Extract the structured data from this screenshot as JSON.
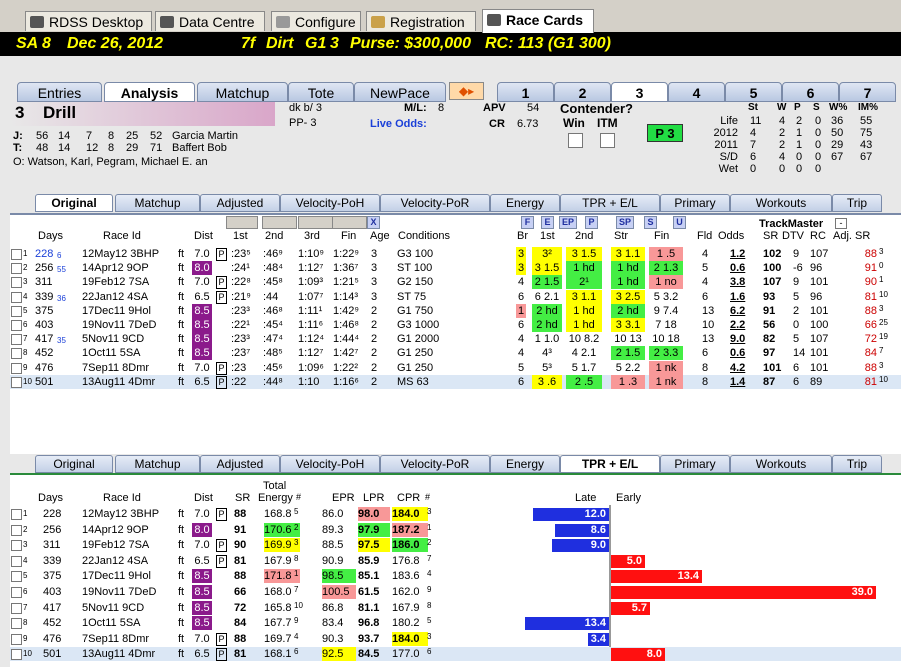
{
  "top_tabs": [
    {
      "label": "RDSS Desktop",
      "icon": "horse-icon"
    },
    {
      "label": "Data Centre",
      "icon": "database-icon"
    },
    {
      "label": "Configure",
      "icon": "gear-icon"
    },
    {
      "label": "Registration",
      "icon": "key-icon"
    },
    {
      "label": "Race Cards",
      "icon": "document-icon"
    }
  ],
  "header": {
    "track": "SA",
    "race": "8",
    "date": "Dec 26, 2012",
    "dist": "7f",
    "surface": "Dirt",
    "grade": "G1",
    "num": "3",
    "purse": "Purse: $300,000",
    "rc": "RC: 113  (G1 300)"
  },
  "race_tabs": [
    "1",
    "2",
    "3",
    "4",
    "5",
    "6",
    "7"
  ],
  "view_tabs": [
    "Entries",
    "Analysis",
    "Matchup",
    "Tote",
    "NewPace"
  ],
  "horse": {
    "num": "3",
    "name": "Drill",
    "dk": "dk b/  3",
    "pp": "PP- 3",
    "ml_label": "M/L:",
    "ml": "8",
    "odds_label": "Live Odds:",
    "apv_label": "APV",
    "apv": "54",
    "cr_label": "CR",
    "cr": "6.73",
    "contender": "Contender?",
    "win": "Win",
    "itm": "ITM",
    "p_label": "P 3"
  },
  "connections": {
    "j": [
      "J:",
      "56",
      "14",
      "7",
      "8",
      "25",
      "52",
      "Garcia Martin"
    ],
    "t": [
      "T:",
      "48",
      "14",
      "12",
      "8",
      "29",
      "71",
      "Baffert Bob"
    ],
    "o": "O:  Watson, Karl, Pegram, Michael E. an"
  },
  "stats": {
    "cols": [
      "St",
      "W",
      "P",
      "S",
      "W%",
      "IM%"
    ],
    "rows": [
      [
        "Life",
        "11",
        "4",
        "2",
        "0",
        "36",
        "55"
      ],
      [
        "2012",
        "4",
        "2",
        "1",
        "0",
        "50",
        "75"
      ],
      [
        "2011",
        "7",
        "2",
        "1",
        "0",
        "29",
        "43"
      ],
      [
        "S/D",
        "6",
        "4",
        "0",
        "0",
        "67",
        "67"
      ],
      [
        "Wet",
        "0",
        "0",
        "0",
        "0",
        "",
        ""
      ]
    ]
  },
  "sub_tabs": [
    "Original",
    "Matchup",
    "Adjusted",
    "Velocity-PoH",
    "Velocity-PoR",
    "Energy",
    "TPR + E/L",
    "Primary",
    "Workouts",
    "Trip"
  ],
  "grid1": {
    "headers": {
      "days": "Days",
      "race_id": "Race Id",
      "dist": "Dist",
      "c1": "1st",
      "c2": "2nd",
      "c3": "3rd",
      "fin": "Fin",
      "age": "Age",
      "cond": "Conditions",
      "br": "Br",
      "p1": "1st",
      "p2": "2nd",
      "str": "Str",
      "pfin": "Fin",
      "fld": "Fld",
      "odds": "Odds",
      "trackmaster": "TrackMaster",
      "sr": "SR",
      "dtv": "DTV",
      "rc": "RC",
      "adjsr": "Adj. SR",
      "f": "F",
      "e": "E",
      "ep": "EP",
      "p": "P",
      "sp": "SP",
      "s": "S",
      "u": "U",
      "x": "X"
    },
    "rows": [
      {
        "n": "1",
        "days": "228",
        "ds": "6",
        "id": "12May12 3BHP",
        "surf": "ft",
        "dist": "7.0",
        "dc": "",
        "pm": "P",
        "c1": ":23⁵",
        "c2": ":46⁹",
        "c3": "1:10⁹",
        "fin": "1:22⁹",
        "age": "3",
        "cond": "G3 100",
        "br": "3",
        "p1": "3²",
        "p2": "3 1.5",
        "str": "3 1.1",
        "pfin": "1 .5",
        "fld": "4",
        "odds": "1.2",
        "sr": "102",
        "dtv": "9",
        "rc": "107",
        "adj": "88",
        "as": "3"
      },
      {
        "n": "2",
        "days": "256",
        "ds": "55",
        "id": "14Apr12 9OP",
        "surf": "ft",
        "dist": "8.0",
        "dc": "pp",
        "pm": "",
        "c1": ":24¹",
        "c2": ":48⁴",
        "c3": "1:12⁷",
        "fin": "1:36⁷",
        "age": "3",
        "cond": "ST 100",
        "br": "3",
        "p1": "3 1.5",
        "p2": "1 hd",
        "str": "1 hd",
        "pfin": "2 1.3",
        "fld": "5",
        "odds": "0.6",
        "sr": "100",
        "dtv": "-6",
        "rc": "96",
        "adj": "91",
        "as": "0"
      },
      {
        "n": "3",
        "days": "311",
        "ds": "",
        "id": "19Feb12 7SA",
        "surf": "ft",
        "dist": "7.0",
        "dc": "",
        "pm": "P",
        "c1": ":22⁸",
        "c2": ":45⁸",
        "c3": "1:09³",
        "fin": "1:21⁵",
        "age": "3",
        "cond": "G2 150",
        "br": "4",
        "p1": "2 1.5",
        "p2": "2¹",
        "str": "1 hd",
        "pfin": "1 no",
        "fld": "4",
        "odds": "3.8",
        "sr": "107",
        "dtv": "9",
        "rc": "101",
        "adj": "90",
        "as": "1"
      },
      {
        "n": "4",
        "days": "339",
        "ds": "36",
        "id": "22Jan12 4SA",
        "surf": "ft",
        "dist": "6.5",
        "dc": "",
        "pm": "P",
        "c1": ":21⁹",
        "c2": ":44",
        "c3": "1:07⁷",
        "fin": "1:14³",
        "age": "3",
        "cond": "ST 75",
        "br": "6",
        "p1": "6 2.1",
        "p2": "3 1.1",
        "str": "3 2.5",
        "pfin": "5 3.2",
        "fld": "6",
        "odds": "1.6",
        "sr": "93",
        "dtv": "5",
        "rc": "96",
        "adj": "81",
        "as": "10"
      },
      {
        "n": "5",
        "days": "375",
        "ds": "",
        "id": "17Dec11 9Hol",
        "surf": "ft",
        "dist": "8.5",
        "dc": "pp",
        "pm": "",
        "c1": ":23³",
        "c2": ":46⁸",
        "c3": "1:11¹",
        "fin": "1:42⁹",
        "age": "2",
        "cond": "G1 750",
        "br": "1",
        "p1": "2 hd",
        "p2": "1 hd",
        "str": "2 hd",
        "pfin": "9 7.4",
        "fld": "13",
        "odds": "6.2",
        "sr": "91",
        "dtv": "2",
        "rc": "101",
        "adj": "88",
        "as": "3"
      },
      {
        "n": "6",
        "days": "403",
        "ds": "",
        "id": "19Nov11 7DeD",
        "surf": "ft",
        "dist": "8.5",
        "dc": "pp",
        "pm": "",
        "c1": ":22¹",
        "c2": ":45⁴",
        "c3": "1:11⁶",
        "fin": "1:46⁸",
        "age": "2",
        "cond": "G3 1000",
        "br": "6",
        "p1": "2 hd",
        "p2": "1 hd",
        "str": "3 3.1",
        "pfin": "7 18",
        "fld": "10",
        "odds": "2.2",
        "sr": "56",
        "dtv": "0",
        "rc": "100",
        "adj": "66",
        "as": "25"
      },
      {
        "n": "7",
        "days": "417",
        "ds": "35",
        "id": "5Nov11 9CD",
        "surf": "ft",
        "dist": "8.5",
        "dc": "pp",
        "pm": "",
        "c1": ":23³",
        "c2": ":47⁴",
        "c3": "1:12⁴",
        "fin": "1:44⁴",
        "age": "2",
        "cond": "G1 2000",
        "br": "4",
        "p1": "1 1.0",
        "p2": "10 8.2",
        "str": "10 13",
        "pfin": "10 18",
        "fld": "13",
        "odds": "9.0",
        "sr": "82",
        "dtv": "5",
        "rc": "107",
        "adj": "72",
        "as": "19"
      },
      {
        "n": "8",
        "days": "452",
        "ds": "",
        "id": "1Oct11 5SA",
        "surf": "ft",
        "dist": "8.5",
        "dc": "pp",
        "pm": "",
        "c1": ":23⁷",
        "c2": ":48⁵",
        "c3": "1:12⁷",
        "fin": "1:42⁷",
        "age": "2",
        "cond": "G1 250",
        "br": "4",
        "p1": "4³",
        "p2": "4 2.1",
        "str": "2 1.5",
        "pfin": "2 3.3",
        "fld": "6",
        "odds": "0.6",
        "sr": "97",
        "dtv": "14",
        "rc": "101",
        "adj": "84",
        "as": "7"
      },
      {
        "n": "9",
        "days": "476",
        "ds": "",
        "id": "7Sep11 8Dmr",
        "surf": "ft",
        "dist": "7.0",
        "dc": "",
        "pm": "P",
        "c1": ":23",
        "c2": ":45⁶",
        "c3": "1:09⁶",
        "fin": "1:22²",
        "age": "2",
        "cond": "G1 250",
        "br": "5",
        "p1": "5³",
        "p2": "5 1.7",
        "str": "5 2.2",
        "pfin": "1 nk",
        "fld": "8",
        "odds": "4.2",
        "sr": "101",
        "dtv": "6",
        "rc": "101",
        "adj": "88",
        "as": "3"
      },
      {
        "n": "10",
        "days": "501",
        "ds": "",
        "id": "13Aug11 4Dmr",
        "surf": "ft",
        "dist": "6.5",
        "dc": "",
        "pm": "P",
        "c1": ":22",
        "c2": ":44⁸",
        "c3": "1:10",
        "fin": "1:16⁶",
        "age": "2",
        "cond": "MS 63",
        "br": "6",
        "p1": "3 .6",
        "p2": "2 .5",
        "str": "1 .3",
        "pfin": "1 nk",
        "fld": "8",
        "odds": "1.4",
        "sr": "87",
        "dtv": "6",
        "rc": "89",
        "adj": "81",
        "as": "10"
      }
    ]
  },
  "grid2": {
    "headers": {
      "days": "Days",
      "race_id": "Race Id",
      "dist": "Dist",
      "sr": "SR",
      "total": "Total",
      "energy": "Energy",
      "hash": "#",
      "epr": "EPR",
      "lpr": "LPR",
      "cpr": "CPR",
      "late": "Late",
      "early": "Early"
    },
    "rows": [
      {
        "n": "1",
        "days": "228",
        "id": "12May12 3BHP",
        "surf": "ft",
        "dist": "7.0",
        "dc": "",
        "pm": "P",
        "sr": "88",
        "en": "168.8",
        "es": "5",
        "epr": "86.0",
        "lpr": "98.0",
        "cpr": "184.0",
        "cs": "3",
        "late": 12.0,
        "early": null
      },
      {
        "n": "2",
        "days": "256",
        "id": "14Apr12 9OP",
        "surf": "ft",
        "dist": "8.0",
        "dc": "pp",
        "pm": "",
        "sr": "91",
        "en": "170.6",
        "es": "2",
        "epr": "89.3",
        "lpr": "97.9",
        "cpr": "187.2",
        "cs": "1",
        "late": 8.6,
        "early": null
      },
      {
        "n": "3",
        "days": "311",
        "id": "19Feb12 7SA",
        "surf": "ft",
        "dist": "7.0",
        "dc": "",
        "pm": "P",
        "sr": "90",
        "en": "169.9",
        "es": "3",
        "epr": "88.5",
        "lpr": "97.5",
        "cpr": "186.0",
        "cs": "2",
        "late": 9.0,
        "early": null
      },
      {
        "n": "4",
        "days": "339",
        "id": "22Jan12 4SA",
        "surf": "ft",
        "dist": "6.5",
        "dc": "",
        "pm": "P",
        "sr": "81",
        "en": "167.9",
        "es": "8",
        "epr": "90.9",
        "lpr": "85.9",
        "cpr": "176.8",
        "cs": "7",
        "late": null,
        "early": 5.0
      },
      {
        "n": "5",
        "days": "375",
        "id": "17Dec11 9Hol",
        "surf": "ft",
        "dist": "8.5",
        "dc": "pp",
        "pm": "",
        "sr": "88",
        "en": "171.8",
        "es": "1",
        "epr": "98.5",
        "lpr": "85.1",
        "cpr": "183.6",
        "cs": "4",
        "late": null,
        "early": 13.4
      },
      {
        "n": "6",
        "days": "403",
        "id": "19Nov11 7DeD",
        "surf": "ft",
        "dist": "8.5",
        "dc": "pp",
        "pm": "",
        "sr": "66",
        "en": "168.0",
        "es": "7",
        "epr": "100.5",
        "lpr": "61.5",
        "cpr": "162.0",
        "cs": "9",
        "late": null,
        "early": 39.0
      },
      {
        "n": "7",
        "days": "417",
        "id": "5Nov11 9CD",
        "surf": "ft",
        "dist": "8.5",
        "dc": "pp",
        "pm": "",
        "sr": "72",
        "en": "165.8",
        "es": "10",
        "epr": "86.8",
        "lpr": "81.1",
        "cpr": "167.9",
        "cs": "8",
        "late": null,
        "early": 5.7
      },
      {
        "n": "8",
        "days": "452",
        "id": "1Oct11 5SA",
        "surf": "ft",
        "dist": "8.5",
        "dc": "pp",
        "pm": "",
        "sr": "84",
        "en": "167.7",
        "es": "9",
        "epr": "83.4",
        "lpr": "96.8",
        "cpr": "180.2",
        "cs": "5",
        "late": 13.4,
        "early": null
      },
      {
        "n": "9",
        "days": "476",
        "id": "7Sep11 8Dmr",
        "surf": "ft",
        "dist": "7.0",
        "dc": "",
        "pm": "P",
        "sr": "88",
        "en": "169.7",
        "es": "4",
        "epr": "90.3",
        "lpr": "93.7",
        "cpr": "184.0",
        "cs": "3",
        "late": 3.4,
        "early": null
      },
      {
        "n": "10",
        "days": "501",
        "id": "13Aug11 4Dmr",
        "surf": "ft",
        "dist": "6.5",
        "dc": "",
        "pm": "P",
        "sr": "81",
        "en": "168.1",
        "es": "6",
        "epr": "92.5",
        "lpr": "84.5",
        "cpr": "177.0",
        "cs": "6",
        "late": null,
        "early": 8.0
      }
    ]
  },
  "colors": {
    "yellow": "#ffff00",
    "green": "#44ee44",
    "pink": "#f89898",
    "purple": "#8b1a8b",
    "blue": "#1f2fdf",
    "red": "#ff1010"
  }
}
